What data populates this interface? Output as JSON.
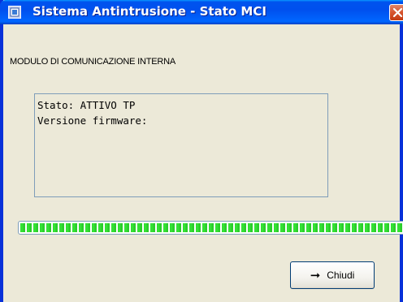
{
  "window": {
    "title": "Sistema Antintrusione - Stato MCI",
    "icon": "app-icon",
    "close_icon": "close-icon"
  },
  "module_label": "MODULO DI COMUNICAZIONE INTERNA",
  "status": {
    "lines": [
      "Stato: ATTIVO TP",
      "Versione firmware:"
    ]
  },
  "progress": {
    "value": 1.0,
    "color": "#2bdb2b"
  },
  "buttons": {
    "close_label": "Chiudi",
    "close_icon": "arrow-right-icon"
  },
  "colors": {
    "titlebar": "#0053ee",
    "frame": "#0831d9",
    "background": "#ece9d8",
    "close_red": "#d6542e"
  }
}
